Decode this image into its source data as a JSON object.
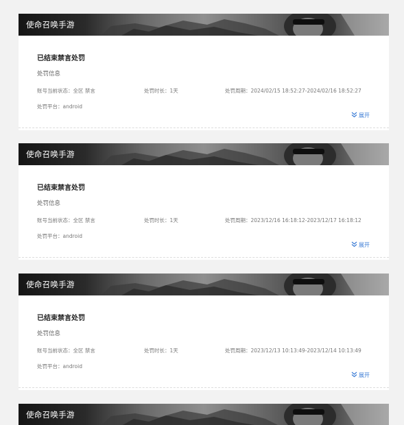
{
  "records": [
    {
      "game_name": "使命召唤手游",
      "status_title": "已结束禁言处罚",
      "section_title": "处罚信息",
      "account_status": "账号当前状态：全区 禁言",
      "duration": "处罚时长：1天",
      "period": "处罚周期：2024/02/15 18:52:27-2024/02/16 18:52:27",
      "platform": "处罚平台：android",
      "expand_label": "展开"
    },
    {
      "game_name": "使命召唤手游",
      "status_title": "已结束禁言处罚",
      "section_title": "处罚信息",
      "account_status": "账号当前状态：全区 禁言",
      "duration": "处罚时长：1天",
      "period": "处罚周期：2023/12/16 16:18:12-2023/12/17 16:18:12",
      "platform": "处罚平台：android",
      "expand_label": "展开"
    },
    {
      "game_name": "使命召唤手游",
      "status_title": "已结束禁言处罚",
      "section_title": "处罚信息",
      "account_status": "账号当前状态：全区 禁言",
      "duration": "处罚时长：1天",
      "period": "处罚周期：2023/12/13 10:13:49-2023/12/14 10:13:49",
      "platform": "处罚平台：android",
      "expand_label": "展开"
    },
    {
      "game_name": "使命召唤手游"
    }
  ],
  "colors": {
    "link": "#3a7bd5",
    "page_background": "#f2f2f2",
    "card_background": "#ffffff"
  },
  "icons": {
    "expand": "double-chevron-down-icon"
  }
}
